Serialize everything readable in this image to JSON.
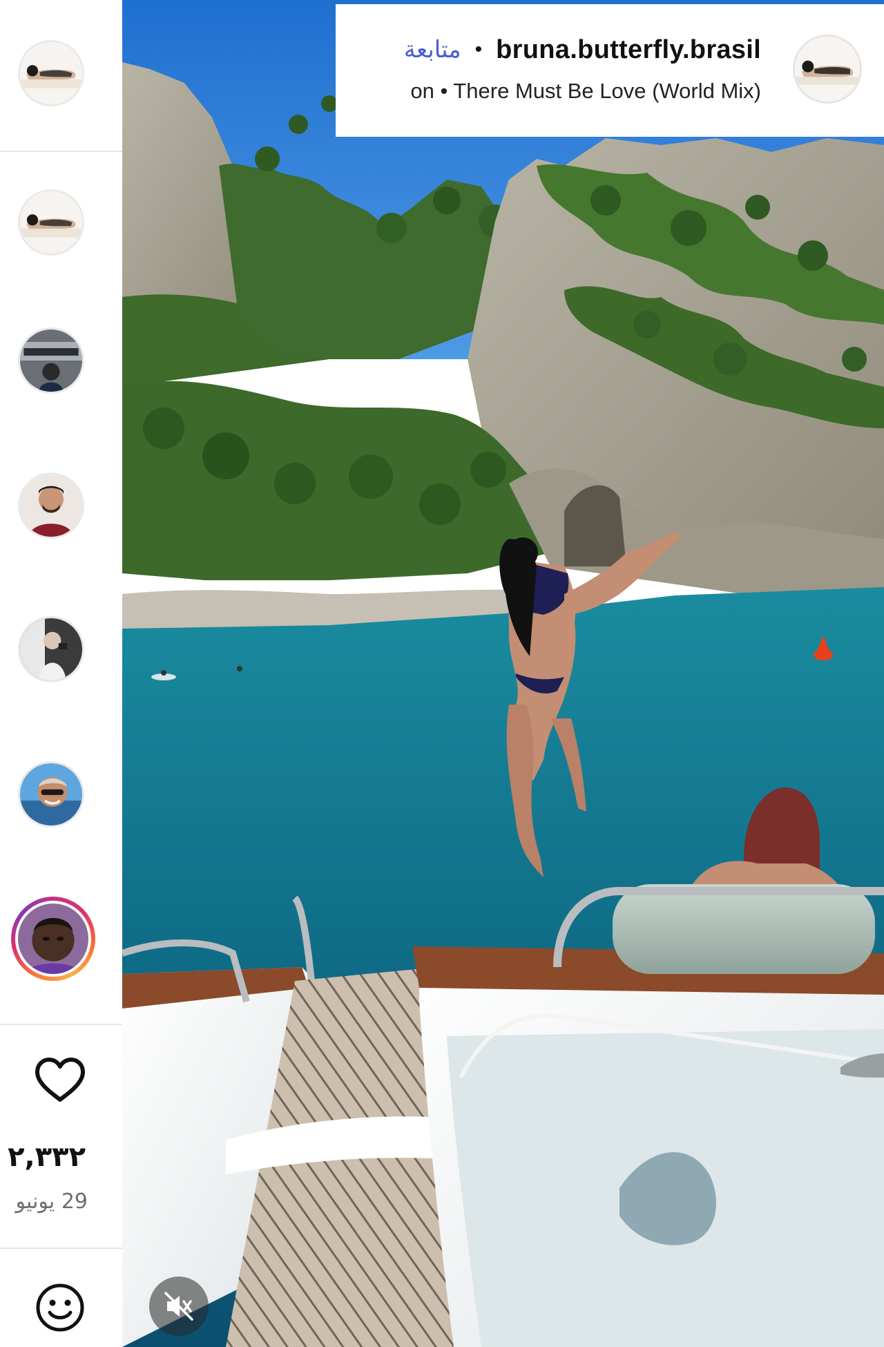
{
  "header": {
    "username": "bruna.butterfly.brasil",
    "separator": "•",
    "follow_label": "متابعة",
    "audio_text": "on • There Must Be Love (World Mix)"
  },
  "sidebar": {
    "avatars": [
      {
        "name": "sidebar-avatar-1",
        "story_ring": false
      },
      {
        "name": "sidebar-avatar-2",
        "story_ring": false
      },
      {
        "name": "sidebar-avatar-3",
        "story_ring": false
      },
      {
        "name": "sidebar-avatar-4",
        "story_ring": false
      },
      {
        "name": "sidebar-avatar-5",
        "story_ring": false
      },
      {
        "name": "sidebar-avatar-6",
        "story_ring": false
      },
      {
        "name": "sidebar-avatar-7",
        "story_ring": true
      }
    ],
    "likes": "٢,٣٣٢ ",
    "date": "29 يونيو"
  },
  "icons": {
    "like": "heart-icon",
    "emoji": "smiley-icon",
    "mute": "speaker-muted-icon"
  },
  "colors": {
    "follow_link": "#4a5cd6",
    "story_ring_start": "#c13584",
    "story_ring_end": "#fcaf45",
    "sky": "#2f7fd8",
    "sea": "#0f6c86"
  }
}
